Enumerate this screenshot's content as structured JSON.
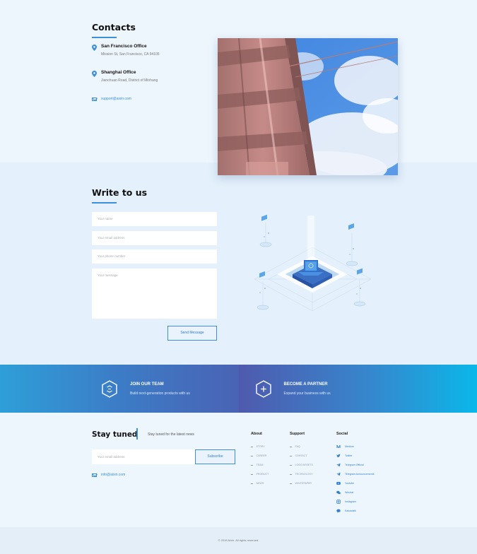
{
  "contacts": {
    "title": "Contacts",
    "offices": [
      {
        "name": "San Francisco Office",
        "address": "Mission St, San Francisco, CA 94105"
      },
      {
        "name": "Shanghai Office",
        "address": "Jianchuan Road, District of Minhang"
      }
    ],
    "email": "support@aixin.com"
  },
  "write": {
    "title": "Write to us",
    "name_placeholder": "Your name",
    "email_placeholder": "Your email address",
    "phone_placeholder": "Your phone number",
    "message_placeholder": "Your message",
    "send_label": "Send Message"
  },
  "banner": {
    "join_title": "JOIN OUR TEAM",
    "join_sub": "Build next-generation products with us",
    "partner_title": "BECOME A PARTNER",
    "partner_sub": "Expand your business with us"
  },
  "footer": {
    "stay_title": "Stay tuned",
    "stay_sub": "Stay tuned for the latest news",
    "email_placeholder": "Your email address",
    "subscribe_label": "Subscribe",
    "contact_email": "info@aixin.com",
    "about": {
      "heading": "About",
      "links": [
        "STORY",
        "CAREER",
        "TEAM",
        "PRODUCT",
        "NEWS"
      ]
    },
    "support": {
      "heading": "Support",
      "links": [
        "FAQ",
        "CONTACT",
        "LOGO ASSETS",
        "TECHNOLOGY",
        "WHITEPAPER"
      ]
    },
    "social": {
      "heading": "Social",
      "links": [
        {
          "label": "Medium",
          "icon": "medium-icon"
        },
        {
          "label": "Twitter",
          "icon": "twitter-icon"
        },
        {
          "label": "Telegram Official",
          "icon": "telegram-icon"
        },
        {
          "label": "Telegram Announcements",
          "icon": "telegram-icon"
        },
        {
          "label": "Youtube",
          "icon": "youtube-icon"
        },
        {
          "label": "Wechat",
          "icon": "wechat-icon"
        },
        {
          "label": "Instagram",
          "icon": "instagram-icon"
        },
        {
          "label": "Kakaotalk",
          "icon": "kakaotalk-icon"
        }
      ]
    },
    "copyright": "© 2018 Aixin. All rights reserved."
  },
  "colors": {
    "accent": "#3d8fd9",
    "background": "#eef6fd",
    "section_alt": "#e4f0fb"
  }
}
